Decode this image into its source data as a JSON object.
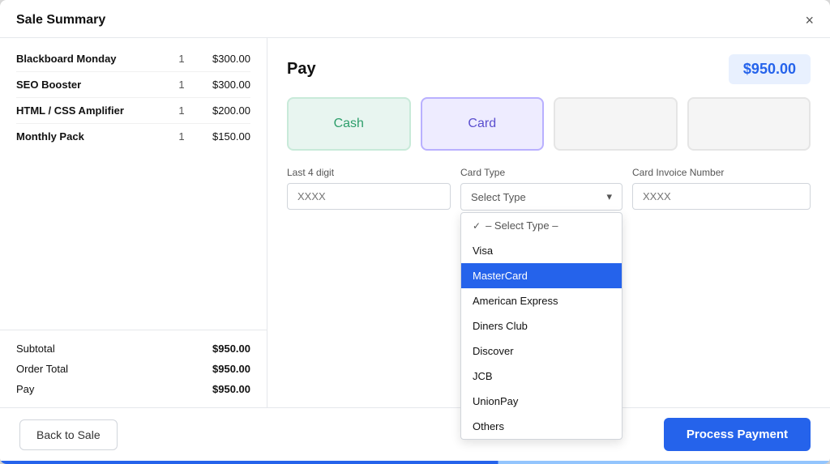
{
  "modal": {
    "title": "Sale Summary",
    "close_label": "×"
  },
  "sale_items": [
    {
      "name": "Blackboard Monday",
      "qty": "1",
      "price": "$300.00"
    },
    {
      "name": "SEO Booster",
      "qty": "1",
      "price": "$300.00"
    },
    {
      "name": "HTML / CSS Amplifier",
      "qty": "1",
      "price": "$200.00"
    },
    {
      "name": "Monthly Pack",
      "qty": "1",
      "price": "$150.00"
    }
  ],
  "summary": {
    "subtotal_label": "Subtotal",
    "subtotal_value": "$950.00",
    "order_total_label": "Order Total",
    "order_total_value": "$950.00",
    "pay_label": "Pay",
    "pay_value": "$950.00"
  },
  "pay_panel": {
    "title": "Pay",
    "amount": "$950.00",
    "methods": [
      {
        "id": "cash",
        "label": "Cash",
        "state": "cash"
      },
      {
        "id": "card",
        "label": "Card",
        "state": "card"
      },
      {
        "id": "method3",
        "label": "",
        "state": "inactive"
      },
      {
        "id": "method4",
        "label": "",
        "state": "inactive"
      }
    ],
    "form": {
      "last4_label": "Last 4 digit",
      "last4_placeholder": "XXXX",
      "cardtype_label": "Card Type",
      "cardtype_selected": "Select Type",
      "invoice_label": "Card Invoice Number",
      "invoice_placeholder": "XXXX"
    },
    "dropdown": {
      "options": [
        {
          "id": "select",
          "label": "– Select Type –",
          "state": "placeholder"
        },
        {
          "id": "visa",
          "label": "Visa",
          "state": "normal"
        },
        {
          "id": "mastercard",
          "label": "MasterCard",
          "state": "selected"
        },
        {
          "id": "amex",
          "label": "American Express",
          "state": "normal"
        },
        {
          "id": "diners",
          "label": "Diners Club",
          "state": "normal"
        },
        {
          "id": "discover",
          "label": "Discover",
          "state": "normal"
        },
        {
          "id": "jcb",
          "label": "JCB",
          "state": "normal"
        },
        {
          "id": "unionpay",
          "label": "UnionPay",
          "state": "normal"
        },
        {
          "id": "others",
          "label": "Others",
          "state": "normal"
        }
      ]
    }
  },
  "actions": {
    "back_label": "Back to Sale",
    "process_label": "Process Payment"
  }
}
